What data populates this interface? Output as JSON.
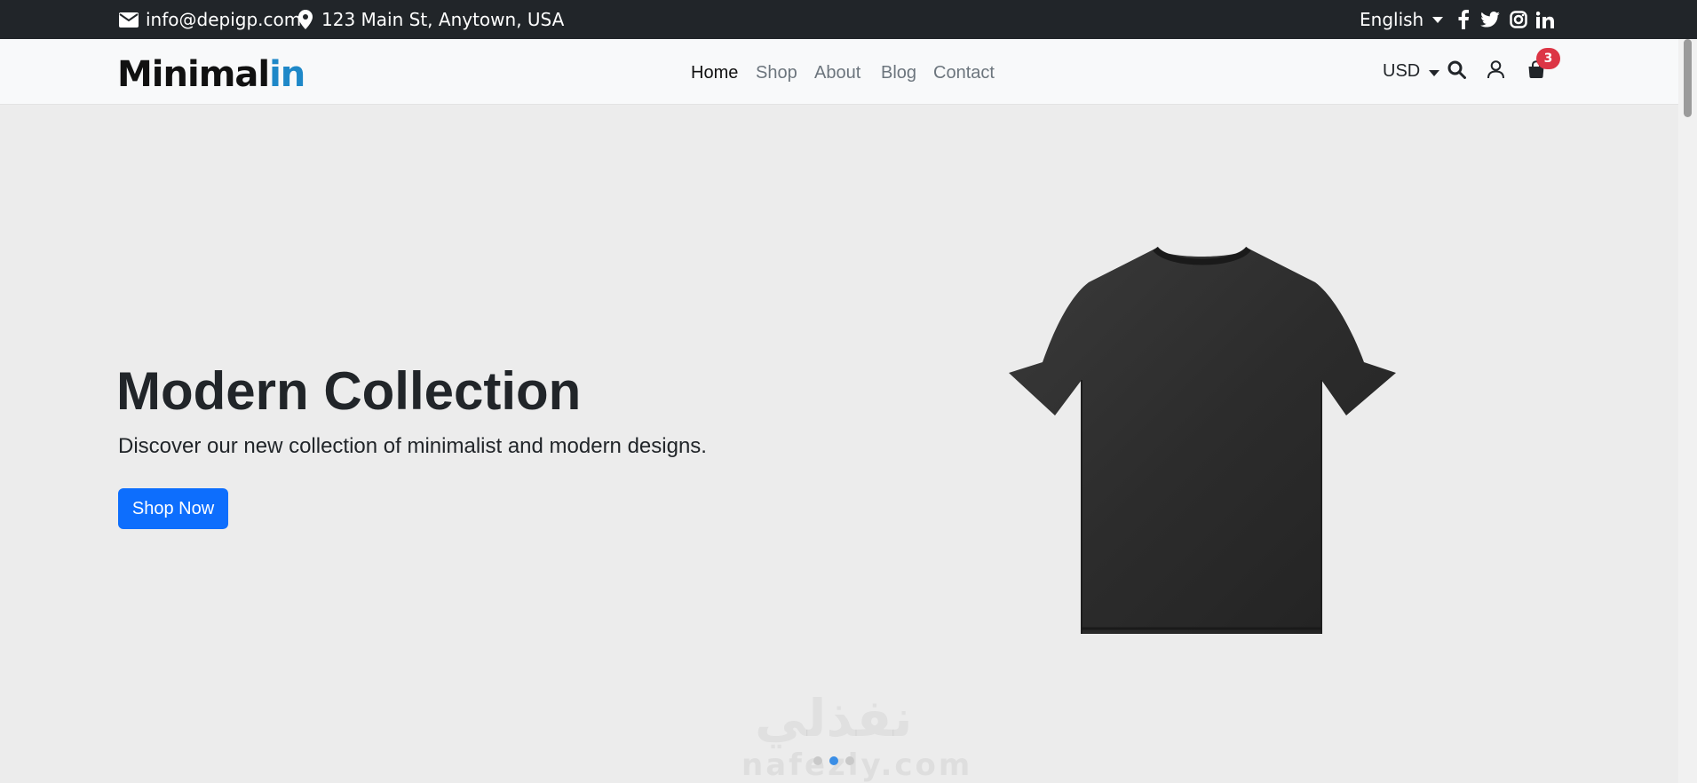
{
  "topbar": {
    "email": "info@depigp.com",
    "address": "123 Main St, Anytown, USA",
    "language": "English",
    "social": [
      "facebook-icon",
      "twitter-icon",
      "instagram-icon",
      "linkedin-icon"
    ]
  },
  "brand": {
    "logo_main": "Minimal",
    "logo_accent": "in",
    "accent_color": "#1e88c8"
  },
  "nav": {
    "links": [
      {
        "label": "Home",
        "active": true
      },
      {
        "label": "Shop",
        "active": false
      },
      {
        "label": "About",
        "active": false
      },
      {
        "label": "Blog",
        "active": false
      },
      {
        "label": "Contact",
        "active": false
      }
    ],
    "currency": "USD",
    "cart_count": "3"
  },
  "hero": {
    "title": "Modern Collection",
    "subtitle": "Discover our new collection of minimalist and modern designs.",
    "cta": "Shop Now",
    "cta_color": "#0d6efd",
    "active_slide": 2,
    "slide_count": 3
  },
  "watermark": {
    "arabic": "نفذلي",
    "latin": "nafezly.com"
  }
}
